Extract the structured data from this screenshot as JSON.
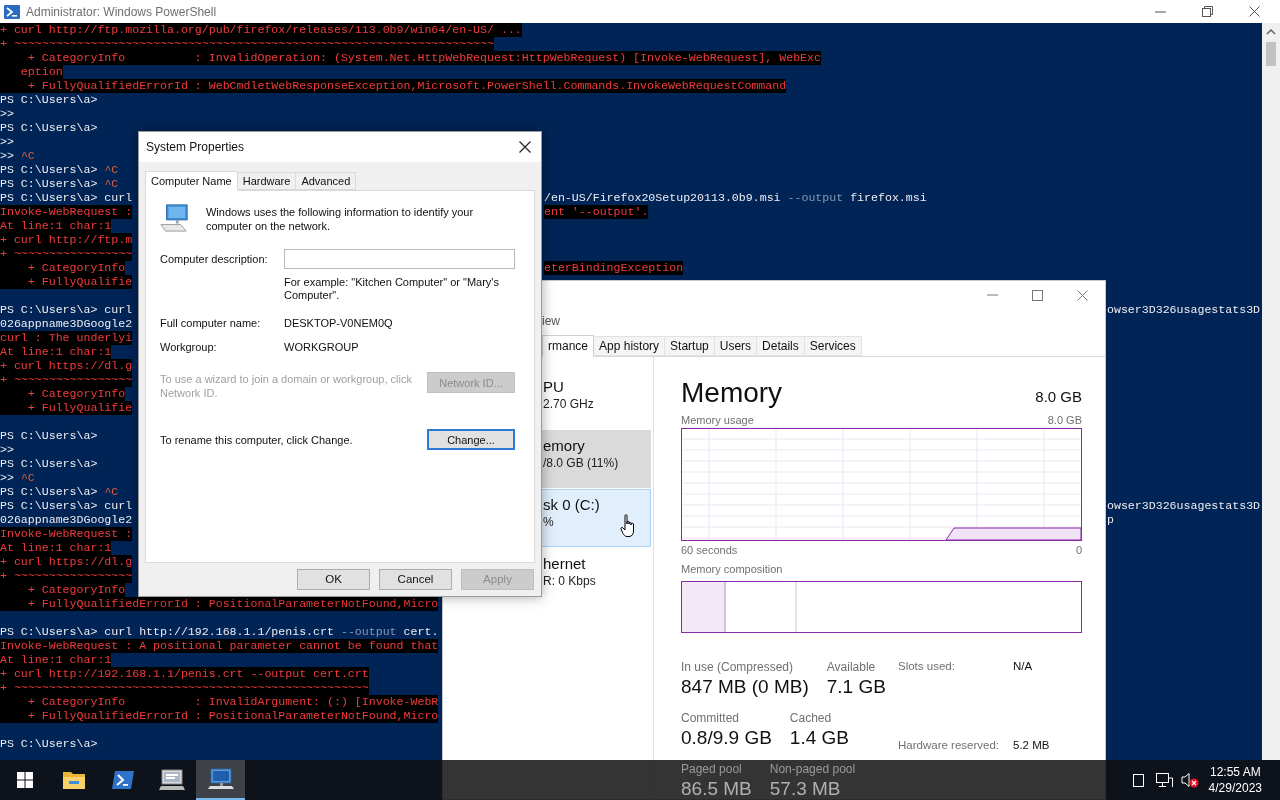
{
  "powershell": {
    "title": "Administrator: Windows PowerShell",
    "lines": [
      {
        "kind": "text",
        "segments": [
          {
            "text": "+ curl http://ftp.mozilla.org/pub/firefox/releases/113.0b9/win64/en-US/ ...",
            "kind": "error"
          }
        ]
      },
      {
        "kind": "text",
        "segments": [
          {
            "text": "+ ~~~~~~~~~~~~~~~~~~~~~~~~~~~~~~~~~~~~~~~~~~~~~~~~~~~~~~~~~~~~~~~~~~~~~",
            "kind": "error"
          }
        ]
      },
      {
        "kind": "text",
        "segments": [
          {
            "text": "    + CategoryInfo          : InvalidOperation: (System.Net.HttpWebRequest:HttpWebRequest) [Invoke-WebRequest], WebExc",
            "kind": "error"
          }
        ]
      },
      {
        "kind": "text",
        "segments": [
          {
            "text": "   eption",
            "kind": "error"
          }
        ]
      },
      {
        "kind": "text",
        "segments": [
          {
            "text": "    + FullyQualifiedErrorId : WebCmdletWebResponseException,Microsoft.PowerShell.Commands.InvokeWebRequestCommand",
            "kind": "error"
          }
        ]
      },
      {
        "kind": "text",
        "segments": [
          {
            "text": "PS C:\\Users\\a>",
            "kind": "plain"
          }
        ]
      },
      {
        "kind": "text",
        "segments": [
          {
            "text": ">>",
            "kind": "plain"
          }
        ]
      },
      {
        "kind": "text",
        "segments": [
          {
            "text": "PS C:\\Users\\a>",
            "kind": "plain"
          }
        ]
      },
      {
        "kind": "text",
        "segments": [
          {
            "text": ">>",
            "kind": "plain"
          }
        ]
      },
      {
        "kind": "text",
        "segments": [
          {
            "text": ">> ",
            "kind": "plain"
          },
          {
            "text": "^C",
            "kind": "ctrl"
          }
        ]
      },
      {
        "kind": "text",
        "segments": [
          {
            "text": "PS C:\\Users\\a> ",
            "kind": "plain"
          },
          {
            "text": "^C",
            "kind": "ctrl"
          }
        ]
      },
      {
        "kind": "text",
        "segments": [
          {
            "text": "PS C:\\Users\\a> ",
            "kind": "plain"
          },
          {
            "text": "^C",
            "kind": "ctrl"
          }
        ]
      },
      {
        "kind": "text",
        "segments": [
          {
            "text": "PS C:\\Users\\a> curl",
            "kind": "plain"
          }
        ],
        "beyond_dialog": [
          {
            "text": "/en-US/Firefox20Setup20113.0b9.msi ",
            "kind": "plain"
          },
          {
            "text": "--output",
            "kind": "dim"
          },
          {
            "text": " firefox.msi",
            "kind": "plain"
          }
        ]
      },
      {
        "kind": "text",
        "segments": [
          {
            "text": "Invoke-WebRequest :",
            "kind": "error"
          }
        ],
        "beyond_dialog": [
          {
            "text": "ent '--output'.",
            "kind": "error"
          }
        ]
      },
      {
        "kind": "text",
        "segments": [
          {
            "text": "At line:1 char:1",
            "kind": "error"
          }
        ]
      },
      {
        "kind": "text",
        "segments": [
          {
            "text": "+ curl http://ftp.m",
            "kind": "error"
          }
        ]
      },
      {
        "kind": "text",
        "segments": [
          {
            "text": "+ ~~~~~~~~~~~~~~~~~",
            "kind": "error"
          }
        ]
      },
      {
        "kind": "text",
        "segments": [
          {
            "text": "    + CategoryInfo",
            "kind": "error"
          }
        ],
        "beyond_dialog": [
          {
            "text": "eterBindingException",
            "kind": "error"
          }
        ]
      },
      {
        "kind": "text",
        "segments": [
          {
            "text": "    + FullyQualifie",
            "kind": "error"
          }
        ]
      },
      {
        "kind": "blank"
      },
      {
        "kind": "text",
        "segments": [
          {
            "text": "PS C:\\Users\\a> curl",
            "kind": "plain"
          }
        ],
        "beyond_task_manager": [
          {
            "text": "owser3D326usagestats3D",
            "kind": "plain"
          }
        ]
      },
      {
        "kind": "text",
        "segments": [
          {
            "text": "026appname3DGoogle2",
            "kind": "plain"
          }
        ]
      },
      {
        "kind": "text",
        "segments": [
          {
            "text": "curl : The underlyi",
            "kind": "error"
          }
        ]
      },
      {
        "kind": "text",
        "segments": [
          {
            "text": "At line:1 char:1",
            "kind": "error"
          }
        ]
      },
      {
        "kind": "text",
        "segments": [
          {
            "text": "+ curl https://dl.g",
            "kind": "error"
          }
        ]
      },
      {
        "kind": "text",
        "segments": [
          {
            "text": "+ ~~~~~~~~~~~~~~~~~",
            "kind": "error"
          }
        ]
      },
      {
        "kind": "text",
        "segments": [
          {
            "text": "    + CategoryInfo",
            "kind": "error"
          }
        ]
      },
      {
        "kind": "text",
        "segments": [
          {
            "text": "    + FullyQualifie",
            "kind": "error"
          }
        ]
      },
      {
        "kind": "blank"
      },
      {
        "kind": "text",
        "segments": [
          {
            "text": "PS C:\\Users\\a>",
            "kind": "plain"
          }
        ]
      },
      {
        "kind": "text",
        "segments": [
          {
            "text": ">>",
            "kind": "plain"
          }
        ]
      },
      {
        "kind": "text",
        "segments": [
          {
            "text": "PS C:\\Users\\a>",
            "kind": "plain"
          }
        ]
      },
      {
        "kind": "text",
        "segments": [
          {
            "text": ">> ",
            "kind": "plain"
          },
          {
            "text": "^C",
            "kind": "ctrl"
          }
        ]
      },
      {
        "kind": "text",
        "segments": [
          {
            "text": "PS C:\\Users\\a> ",
            "kind": "plain"
          },
          {
            "text": "^C",
            "kind": "ctrl"
          }
        ]
      },
      {
        "kind": "text",
        "segments": [
          {
            "text": "PS C:\\Users\\a> curl",
            "kind": "plain"
          }
        ],
        "beyond_task_manager": [
          {
            "text": "owser3D326usagestats3D",
            "kind": "plain"
          }
        ]
      },
      {
        "kind": "text",
        "segments": [
          {
            "text": "026appname3DGoogle2",
            "kind": "plain"
          }
        ],
        "beyond_task_manager": [
          {
            "text": "p",
            "kind": "plain"
          }
        ]
      },
      {
        "kind": "text",
        "segments": [
          {
            "text": "Invoke-WebRequest :",
            "kind": "error"
          }
        ]
      },
      {
        "kind": "text",
        "segments": [
          {
            "text": "At line:1 char:1",
            "kind": "error"
          }
        ]
      },
      {
        "kind": "text",
        "segments": [
          {
            "text": "+ curl https://dl.g",
            "kind": "error"
          }
        ]
      },
      {
        "kind": "text",
        "segments": [
          {
            "text": "+ ~~~~~~~~~~~~~~~~~",
            "kind": "error"
          }
        ]
      },
      {
        "kind": "text",
        "segments": [
          {
            "text": "    + CategoryInfo",
            "kind": "error"
          }
        ]
      },
      {
        "kind": "text",
        "segments": [
          {
            "text": "    + FullyQualifiedErrorId : PositionalParameterNotFound,Micro",
            "kind": "error"
          }
        ]
      },
      {
        "kind": "blank"
      },
      {
        "kind": "text",
        "segments": [
          {
            "text": "PS C:\\Users\\a> curl http://192.168.1.1/penis.crt ",
            "kind": "plain"
          },
          {
            "text": "--output",
            "kind": "dim"
          },
          {
            "text": " cert.",
            "kind": "plain"
          }
        ]
      },
      {
        "kind": "text",
        "segments": [
          {
            "text": "Invoke-WebRequest : A positional parameter cannot be found that",
            "kind": "error"
          }
        ]
      },
      {
        "kind": "text",
        "segments": [
          {
            "text": "At line:1 char:1",
            "kind": "error"
          }
        ]
      },
      {
        "kind": "text",
        "segments": [
          {
            "text": "+ curl http://192.168.1.1/penis.crt --output cert.crt",
            "kind": "error"
          }
        ]
      },
      {
        "kind": "text",
        "segments": [
          {
            "text": "+ ~~~~~~~~~~~~~~~~~~~~~~~~~~~~~~~~~~~~~~~~~~~~~~~~~~~",
            "kind": "error"
          }
        ]
      },
      {
        "kind": "text",
        "segments": [
          {
            "text": "    + CategoryInfo          : InvalidArgument: (:) [Invoke-WebR",
            "kind": "error"
          }
        ]
      },
      {
        "kind": "text",
        "segments": [
          {
            "text": "    + FullyQualifiedErrorId : PositionalParameterNotFound,Micro",
            "kind": "error"
          }
        ]
      },
      {
        "kind": "blank"
      },
      {
        "kind": "text",
        "segments": [
          {
            "text": "PS C:\\Users\\a>",
            "kind": "plain"
          }
        ]
      }
    ]
  },
  "system_properties": {
    "title": "System Properties",
    "tabs": [
      {
        "label": "Computer Name",
        "selected": true
      },
      {
        "label": "Hardware",
        "selected": false
      },
      {
        "label": "Advanced",
        "selected": false
      }
    ],
    "intro": "Windows uses the following information to identify your computer on the network.",
    "description_label": "Computer description:",
    "example": "For example: \"Kitchen Computer\" or \"Mary's Computer\".",
    "fields": [
      {
        "label": "Full computer name:",
        "value": "DESKTOP-V0NEM0Q"
      },
      {
        "label": "Workgroup:",
        "value": "WORKGROUP"
      }
    ],
    "network_id": {
      "text": "To use a wizard to join a domain or workgroup, click Network ID.",
      "button": "Network ID...",
      "disabled": true
    },
    "rename": {
      "text": "To rename this computer, click Change.",
      "button": "Change...",
      "focused": true
    },
    "buttons": [
      {
        "label": "OK",
        "disabled": false
      },
      {
        "label": "Cancel",
        "disabled": false
      },
      {
        "label": "Apply",
        "disabled": true
      }
    ]
  },
  "task_manager": {
    "menu": "iew",
    "tabs": [
      {
        "label": "rmance",
        "selected": true
      },
      {
        "label": "App history",
        "selected": false
      },
      {
        "label": "Startup",
        "selected": false
      },
      {
        "label": "Users",
        "selected": false
      },
      {
        "label": "Details",
        "selected": false
      },
      {
        "label": "Services",
        "selected": false
      }
    ],
    "resources": [
      {
        "name": "PU",
        "detail": "2.70 GHz",
        "selected": false,
        "hovered": false
      },
      {
        "name": "emory",
        "detail": "/8.0 GB (11%)",
        "selected": true,
        "hovered": false
      },
      {
        "name": "sk 0 (C:)",
        "detail": "%",
        "selected": false,
        "hovered": true
      },
      {
        "name": "hernet",
        "detail": "R: 0 Kbps",
        "selected": false,
        "hovered": false
      }
    ],
    "heading": "Memory",
    "total": "8.0 GB",
    "usage_label": "Memory usage",
    "usage_max": "8.0 GB",
    "time_span": "60 seconds",
    "time_end": "0",
    "composition_label": "Memory composition",
    "stats": [
      {
        "label": "In use (Compressed)",
        "value": "847 MB (0 MB)"
      },
      {
        "label": "Available",
        "value": "7.1 GB"
      },
      {
        "label": "Committed",
        "value": "0.8/9.9 GB"
      },
      {
        "label": "Cached",
        "value": "1.4 GB"
      },
      {
        "label": "Paged pool",
        "value": "86.5 MB"
      },
      {
        "label": "Non-paged pool",
        "value": "57.3 MB"
      }
    ],
    "details": [
      {
        "label": "Slots used:",
        "value": "N/A"
      },
      {
        "label": "Hardware reserved:",
        "value": "5.2 MB"
      }
    ]
  },
  "taskbar": {
    "apps": [
      {
        "kind": "start",
        "selected": false
      },
      {
        "kind": "folder",
        "selected": false
      },
      {
        "kind": "terminal",
        "selected": false
      },
      {
        "kind": "settings_window",
        "selected": false
      },
      {
        "kind": "monitor",
        "selected": true
      }
    ],
    "muted": true,
    "time": "12:55 AM",
    "date": "4/29/2023"
  }
}
